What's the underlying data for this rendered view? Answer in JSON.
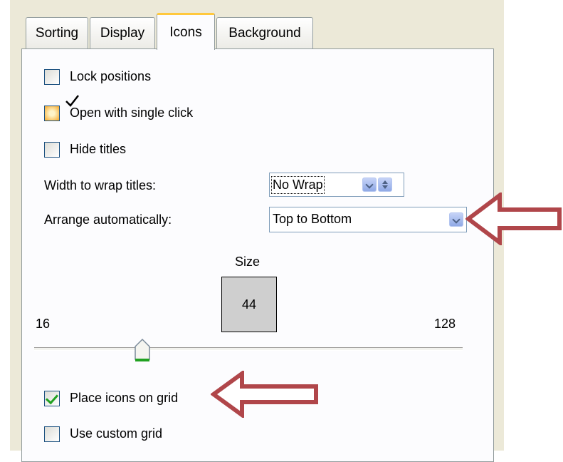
{
  "tabs": [
    {
      "label": "Sorting",
      "active": false
    },
    {
      "label": "Display",
      "active": false
    },
    {
      "label": "Icons",
      "active": true
    },
    {
      "label": "Background",
      "active": false
    }
  ],
  "options": {
    "lock_positions": {
      "label": "Lock positions",
      "checked": false
    },
    "open_single_click": {
      "label": "Open with single click",
      "checked": false,
      "hovered": true
    },
    "hide_titles": {
      "label": "Hide titles",
      "checked": false
    },
    "place_on_grid": {
      "label": "Place icons on grid",
      "checked": true
    },
    "custom_grid": {
      "label": "Use custom grid",
      "checked": false
    }
  },
  "wrap": {
    "label": "Width to wrap titles:",
    "value": "No Wrap"
  },
  "arrange": {
    "label": "Arrange automatically:",
    "value": "Top to Bottom"
  },
  "size": {
    "label": "Size",
    "value": "44",
    "min": "16",
    "max": "128"
  },
  "colors": {
    "annotation_arrow": "#b0464a",
    "tab_highlight": "#ffc83c",
    "checkmark": "#21a121"
  }
}
